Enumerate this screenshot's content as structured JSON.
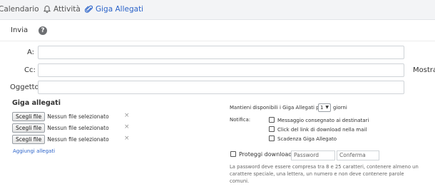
{
  "tabs": [
    {
      "label": "Calendario",
      "icon": "none"
    },
    {
      "label": "Attività",
      "icon": "bell-icon"
    },
    {
      "label": "Giga Allegati",
      "icon": "paperclip-icon"
    }
  ],
  "toolbar": {
    "send_label": "Invia",
    "help_icon": "question-icon",
    "help_symbol": "?"
  },
  "fields": {
    "to_label": "A:",
    "cc_label": "Cc:",
    "show_label": "Mostra",
    "subject_label": "Oggetto:"
  },
  "attachments": {
    "title": "Giga allegati",
    "choose_label": "Scegli file",
    "no_file_label": "Nessun file selezionato",
    "remove_symbol": "×",
    "add_label": "Aggiungi allegati"
  },
  "options": {
    "keep_prefix": "Mantieni disponibili i Giga Allegati per",
    "days_value": "1",
    "keep_suffix": "giorni",
    "notify_label": "Notifica:",
    "notify_items": [
      "Messaggio consegnato ai destinatari",
      "Click del link di download nella mail",
      "Scadenza Giga Allegato"
    ],
    "protect_label": "Proteggi download:",
    "password_placeholder": "Password",
    "confirm_placeholder": "Conferma",
    "password_note": "La password deve essere compresa tra 8 e 25 caratteri, contenere almeno un carattere speciale, una lettera, un numero e non deve contenere parole comuni."
  },
  "colors": {
    "accent": "#2b63c9",
    "topbar_bg": "#f3f4f6"
  }
}
